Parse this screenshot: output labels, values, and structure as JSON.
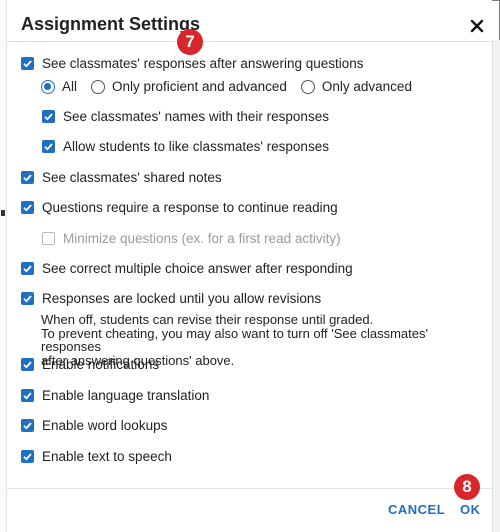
{
  "dialog": {
    "title": "Assignment Settings",
    "close_icon": "close-icon"
  },
  "callouts": {
    "top": "7",
    "bottom": "8"
  },
  "settings": {
    "see_responses": {
      "label": "See classmates' responses after answering questions",
      "checked": true
    },
    "response_scope": {
      "options": [
        "All",
        "Only proficient and advanced",
        "Only advanced"
      ],
      "selected": "All"
    },
    "see_names": {
      "label": "See classmates' names with their responses",
      "checked": true
    },
    "allow_like": {
      "label": "Allow students to like classmates' responses",
      "checked": true
    },
    "shared_notes": {
      "label": "See classmates' shared notes",
      "checked": true
    },
    "require_response": {
      "label": "Questions require a response to continue reading",
      "checked": true
    },
    "minimize_questions": {
      "label": "Minimize questions (ex. for a first read activity)",
      "checked": false,
      "disabled": true
    },
    "correct_mc": {
      "label": "See correct multiple choice answer after responding",
      "checked": true
    },
    "locked_responses": {
      "label": "Responses are locked until you allow revisions",
      "checked": true
    },
    "locked_note": {
      "line1": "When off, students can revise their response until graded.",
      "line2": "To prevent cheating, you may also want to turn off 'See classmates' responses",
      "line3": "after answering questions' above."
    },
    "notifications": {
      "label": "Enable notifications",
      "checked": true
    },
    "translation": {
      "label": "Enable language translation",
      "checked": true
    },
    "word_lookups": {
      "label": "Enable word lookups",
      "checked": true
    },
    "text_to_speech": {
      "label": "Enable text to speech",
      "checked": true
    }
  },
  "footer": {
    "cancel_label": "CANCEL",
    "ok_label": "OK"
  },
  "colors": {
    "accent": "#1f6fc5",
    "callout": "#d9262c"
  }
}
